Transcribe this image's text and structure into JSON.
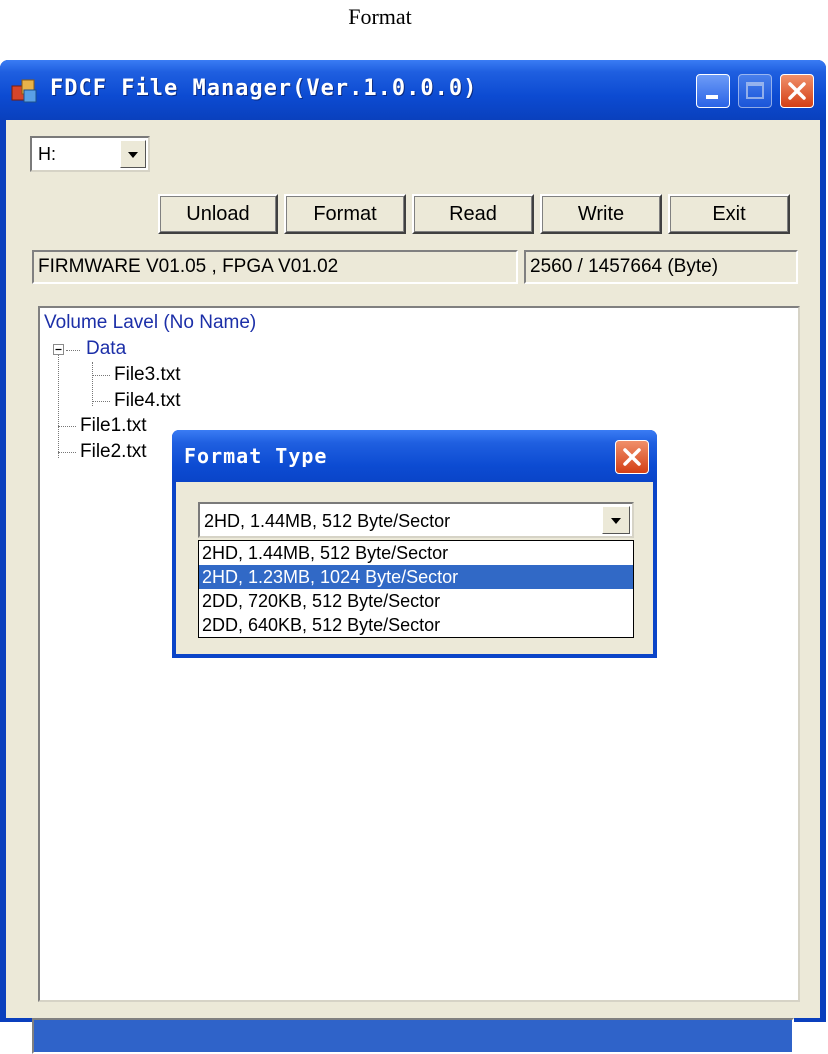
{
  "caption": "Format",
  "window": {
    "title": "FDCF File Manager(Ver.1.0.0.0)",
    "min_glyph": "_",
    "max_glyph": "☐",
    "close_glyph": "✕"
  },
  "toolbar": {
    "drive_value": "H:",
    "unload_label": "Unload",
    "format_label": "Format",
    "read_label": "Read",
    "write_label": "Write",
    "exit_label": "Exit"
  },
  "status": {
    "firmware": "FIRMWARE V01.05 , FPGA V01.02",
    "usage": "2560 / 1457664 (Byte)"
  },
  "tree": {
    "volume": "Volume Lavel (No Name)",
    "folder": "Data",
    "files_in_folder": [
      "File3.txt",
      "File4.txt"
    ],
    "root_files": [
      "File1.txt",
      "File2.txt"
    ]
  },
  "dialog": {
    "title": "Format Type",
    "selected_value": "2HD, 1.44MB, 512 Byte/Sector",
    "options": [
      "2HD, 1.44MB, 512 Byte/Sector",
      "2HD, 1.23MB, 1024 Byte/Sector",
      "2DD, 720KB, 512 Byte/Sector",
      "2DD, 640KB, 512 Byte/Sector"
    ],
    "highlighted_index": 1
  },
  "progress": {
    "fraction": 1.0
  },
  "icons": {
    "dropdown": "chevron-down-icon",
    "close": "close-icon",
    "app": "app-icon",
    "expander": "minus-icon"
  },
  "colors": {
    "title_bar": "#0c4bd2",
    "selection": "#3169c6",
    "tree_text_blue": "#1c2fa8",
    "progress": "#2f63c9"
  }
}
